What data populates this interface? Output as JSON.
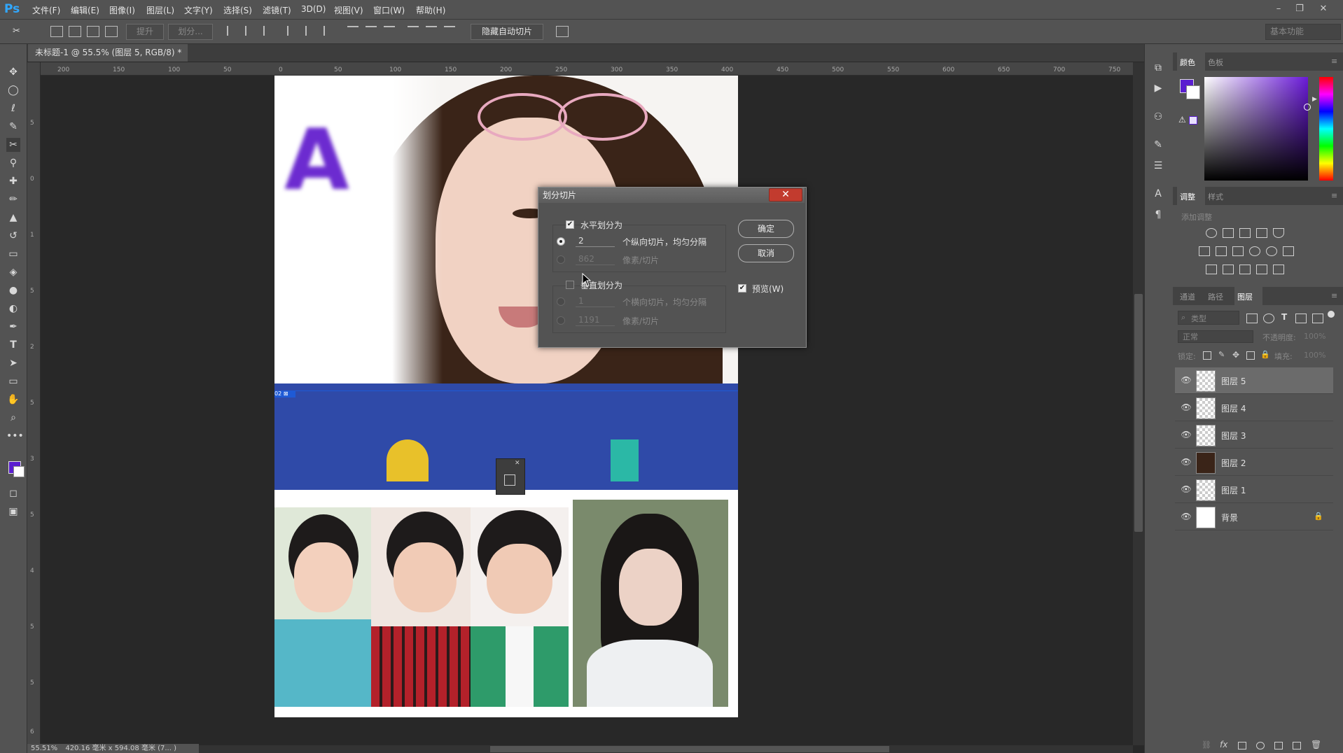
{
  "app": {
    "logo": "Ps"
  },
  "menu": [
    "文件(F)",
    "编辑(E)",
    "图像(I)",
    "图层(L)",
    "文字(Y)",
    "选择(S)",
    "滤镜(T)",
    "3D(D)",
    "视图(V)",
    "窗口(W)",
    "帮助(H)"
  ],
  "options_bar": {
    "btn_lift": "提升",
    "btn_divide": "划分...",
    "btn_hide_auto_slice": "隐藏自动切片",
    "workspace": "基本功能"
  },
  "document": {
    "tab_title": "未标题-1 @ 55.5% (图层 5, RGB/8) *",
    "tab_close": "×",
    "slice_badge": "02 ⊠",
    "letter": "A"
  },
  "rulers": {
    "h": [
      "200",
      "150",
      "100",
      "50",
      "0",
      "50",
      "100",
      "150",
      "200",
      "250",
      "300",
      "350",
      "400",
      "450",
      "500",
      "550",
      "600",
      "650",
      "700",
      "750"
    ],
    "v": [
      "5",
      "0",
      "1",
      "5",
      "2",
      "5",
      "3",
      "5",
      "4",
      "5",
      "5",
      "6"
    ]
  },
  "status": {
    "zoom": "55.51%",
    "doc_size": "420.16 毫米 x 594.08 毫米 (7... )"
  },
  "dialog": {
    "title": "划分切片",
    "close": "✕",
    "horizontal": {
      "label": "水平划分为",
      "count_value": "2",
      "count_suffix": "个纵向切片，均匀分隔",
      "pixels_value": "862",
      "pixels_suffix": "像素/切片"
    },
    "vertical": {
      "label": "垂直划分为",
      "count_value": "1",
      "count_suffix": "个横向切片，均匀分隔",
      "pixels_value": "1191",
      "pixels_suffix": "像素/切片"
    },
    "ok": "确定",
    "cancel": "取消",
    "preview": "预览(W)"
  },
  "panels": {
    "color_tabs": [
      "颜色",
      "色板"
    ],
    "adjust_tabs": [
      "调整",
      "样式"
    ],
    "adjust_add": "添加调整",
    "layer_tabs": [
      "通道",
      "路径",
      "图层"
    ],
    "layer_filter": "类型",
    "blend_mode": "正常",
    "opacity_label": "不透明度:",
    "opacity_value": "100%",
    "lock_label": "锁定:",
    "fill_label": "填充:",
    "fill_value": "100%",
    "layers": [
      {
        "name": "图层 5",
        "selected": true
      },
      {
        "name": "图层 4",
        "selected": false
      },
      {
        "name": "图层 3",
        "selected": false
      },
      {
        "name": "图层 2",
        "selected": false
      },
      {
        "name": "图层 1",
        "selected": false
      },
      {
        "name": "背景",
        "selected": false,
        "locked": true
      }
    ]
  },
  "colors": {
    "foreground": "#5a1ed0",
    "background": "#ffffff",
    "slice_guide": "#1e5ad6"
  },
  "icons": [
    "move-icon",
    "marquee-icon",
    "lasso-icon",
    "quick-select-icon",
    "slice-icon",
    "eyedropper-icon",
    "healing-icon",
    "brush-icon",
    "stamp-icon",
    "history-brush-icon",
    "eraser-icon",
    "paint-bucket-icon",
    "blur-icon",
    "dodge-icon",
    "pen-icon",
    "type-icon",
    "path-select-icon",
    "rectangle-icon",
    "hand-icon",
    "zoom-icon",
    "more-icon"
  ]
}
